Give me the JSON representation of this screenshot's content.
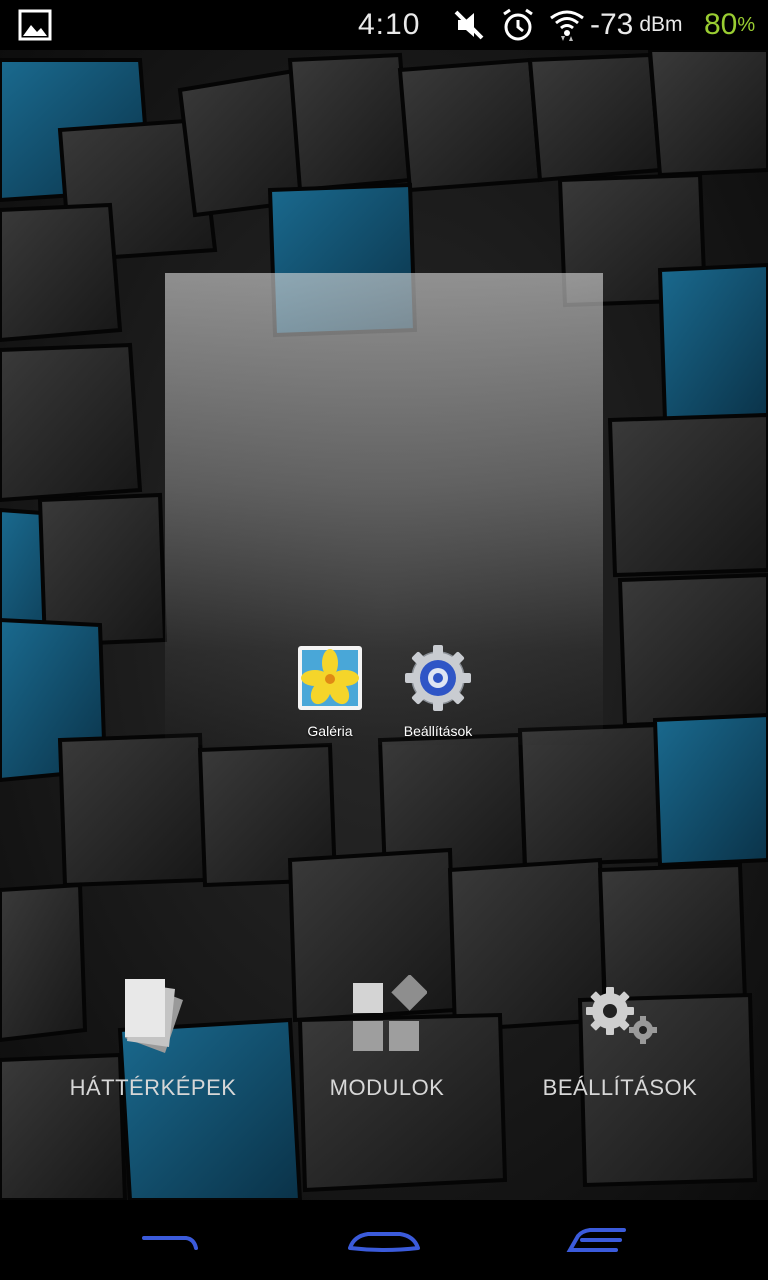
{
  "status_bar": {
    "time": "4:10",
    "signal_value": "-73",
    "signal_unit": "dBm",
    "battery_value": "80",
    "battery_unit": "%",
    "icons": [
      "gallery-notification-icon",
      "mute-icon",
      "alarm-icon",
      "wifi-icon"
    ]
  },
  "preview": {
    "apps": [
      {
        "label": "Galéria",
        "icon": "gallery-app-icon"
      },
      {
        "label": "Beállítások",
        "icon": "settings-app-icon"
      }
    ]
  },
  "options": [
    {
      "label": "HÁTTÉRKÉPEK",
      "icon": "wallpapers-icon"
    },
    {
      "label": "MODULOK",
      "icon": "widgets-icon"
    },
    {
      "label": "BEÁLLÍTÁSOK",
      "icon": "settings-gears-icon"
    }
  ],
  "navigation": {
    "buttons": [
      "back-icon",
      "home-icon",
      "recents-icon"
    ],
    "accent_color": "#3b5bdb"
  },
  "colors": {
    "battery": "#9acd32",
    "wallpaper_blue": "#0d4a66"
  }
}
